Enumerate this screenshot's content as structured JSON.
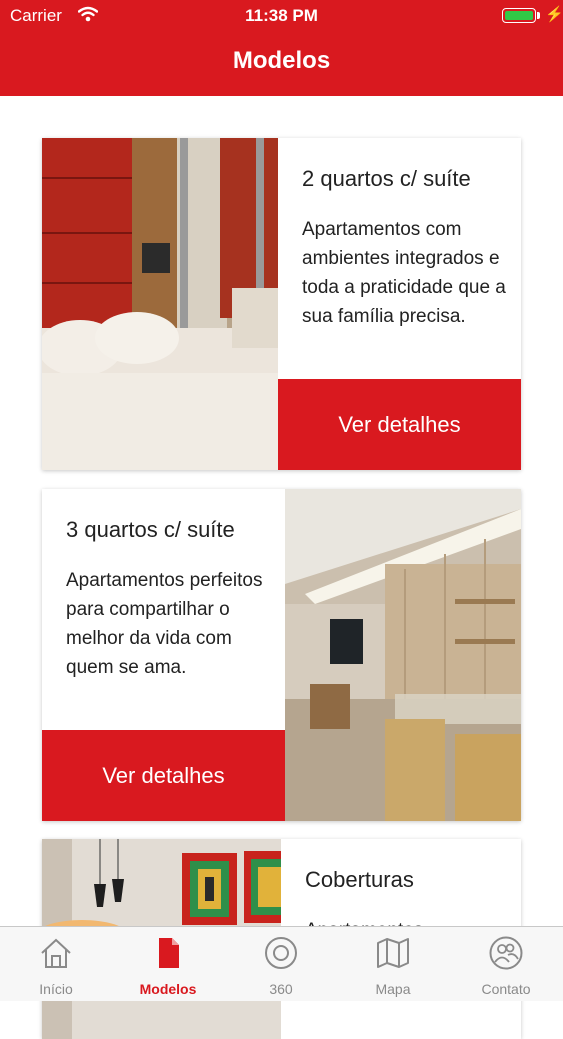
{
  "status_bar": {
    "carrier": "Carrier",
    "time": "11:38 PM"
  },
  "nav": {
    "title": "Modelos"
  },
  "cards": [
    {
      "title": "2 quartos c/ suíte",
      "description": "Apartamentos com ambientes integrados e toda a praticidade que a sua família precisa.",
      "button_label": "Ver detalhes"
    },
    {
      "title": "3 quartos c/ suíte",
      "description": "Apartamentos perfeitos para compartilhar o melhor da vida com quem se ama.",
      "button_label": "Ver detalhes"
    },
    {
      "title": "Coberturas",
      "description": "Apartamentos",
      "button_label": ""
    }
  ],
  "tabbar": {
    "items": [
      {
        "label": "Início",
        "icon": "home-icon"
      },
      {
        "label": "Modelos",
        "icon": "document-icon"
      },
      {
        "label": "360",
        "icon": "360-icon"
      },
      {
        "label": "Mapa",
        "icon": "map-icon"
      },
      {
        "label": "Contato",
        "icon": "contacts-icon"
      }
    ],
    "active_index": 1
  },
  "colors": {
    "brand_red": "#d9191f",
    "inactive_gray": "#8a8a8a",
    "battery_green": "#31c846"
  }
}
